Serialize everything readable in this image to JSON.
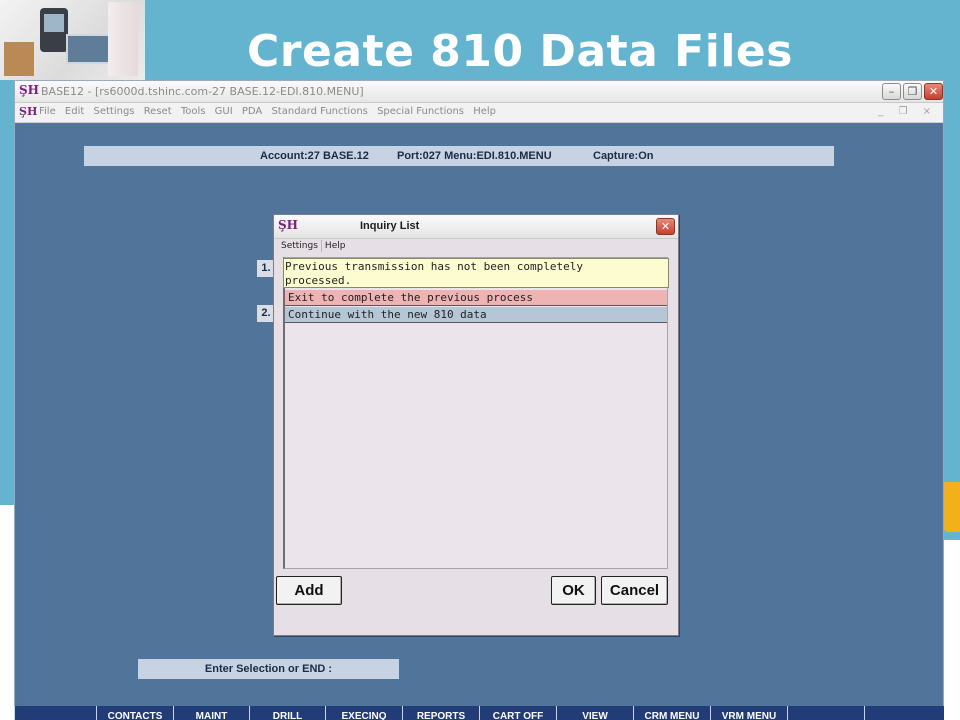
{
  "slide": {
    "title": "Create 810 Data Files"
  },
  "window": {
    "title": "BASE12 - [rs6000d.tshinc.com-27 BASE.12-EDI.810.MENU]",
    "menu": [
      "File",
      "Edit",
      "Settings",
      "Reset",
      "Tools",
      "GUI",
      "PDA",
      "Standard Functions",
      "Special Functions",
      "Help"
    ]
  },
  "status": {
    "account": "Account:27 BASE.12",
    "port": "Port:027 Menu:EDI.810.MENU",
    "capture": "Capture:On"
  },
  "menu_numbers": [
    "1.",
    "2."
  ],
  "dialog": {
    "title": "Inquiry List",
    "menu": [
      "Settings",
      "Help"
    ],
    "message_line1": "Previous transmission has not been completely",
    "message_line2": "processed.",
    "items": [
      "Exit to complete the previous process",
      "Continue with the new 810 data"
    ],
    "buttons": {
      "add": "Add",
      "ok": "OK",
      "cancel": "Cancel"
    }
  },
  "prompt": "Enter Selection or END :",
  "function_keys": [
    "",
    "CONTACTS",
    "MAINT",
    "DRILL",
    "EXECINQ",
    "REPORTS",
    "CART OFF",
    "VIEW",
    "CRM MENU",
    "VRM MENU",
    "",
    ""
  ],
  "colors": {
    "slide_bg": "#64b4cf",
    "workarea_bg": "#51749b",
    "message_bg": "#fdfcd1",
    "item_exit_bg": "#eeb4b4",
    "item_continue_bg": "#b6c6d6",
    "function_strip_bg": "#223c78"
  },
  "icons": {
    "app": "tsh-logo-icon",
    "close": "close-icon",
    "minimize": "minimize-icon",
    "maximize": "maximize-icon"
  }
}
